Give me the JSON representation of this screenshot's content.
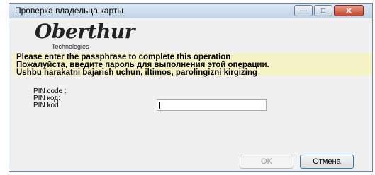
{
  "window": {
    "title": "Проверка владельца карты"
  },
  "logo": {
    "wordmark": "Oberthur",
    "subtitle": "Technologies"
  },
  "message": {
    "line1": "Please enter the passphrase to complete this operation",
    "line2": "Пожалуйста, введите пароль для выполнения этой операции.",
    "line3": "Ushbu harakatni bajarish uchun, iltimos, parolingizni kirgizing"
  },
  "pin": {
    "label_en": "PIN code :",
    "label_ru": "PIN код:",
    "label_uz": "PIN kod",
    "value": ""
  },
  "buttons": {
    "ok": "OK",
    "cancel": "Отмена"
  },
  "colors": {
    "message_background": "#f5f2c5",
    "dialog_background": "#f0f0f0",
    "close_button": "#c7452c"
  },
  "icons": [
    "minimize-icon",
    "maximize-icon",
    "close-icon"
  ]
}
